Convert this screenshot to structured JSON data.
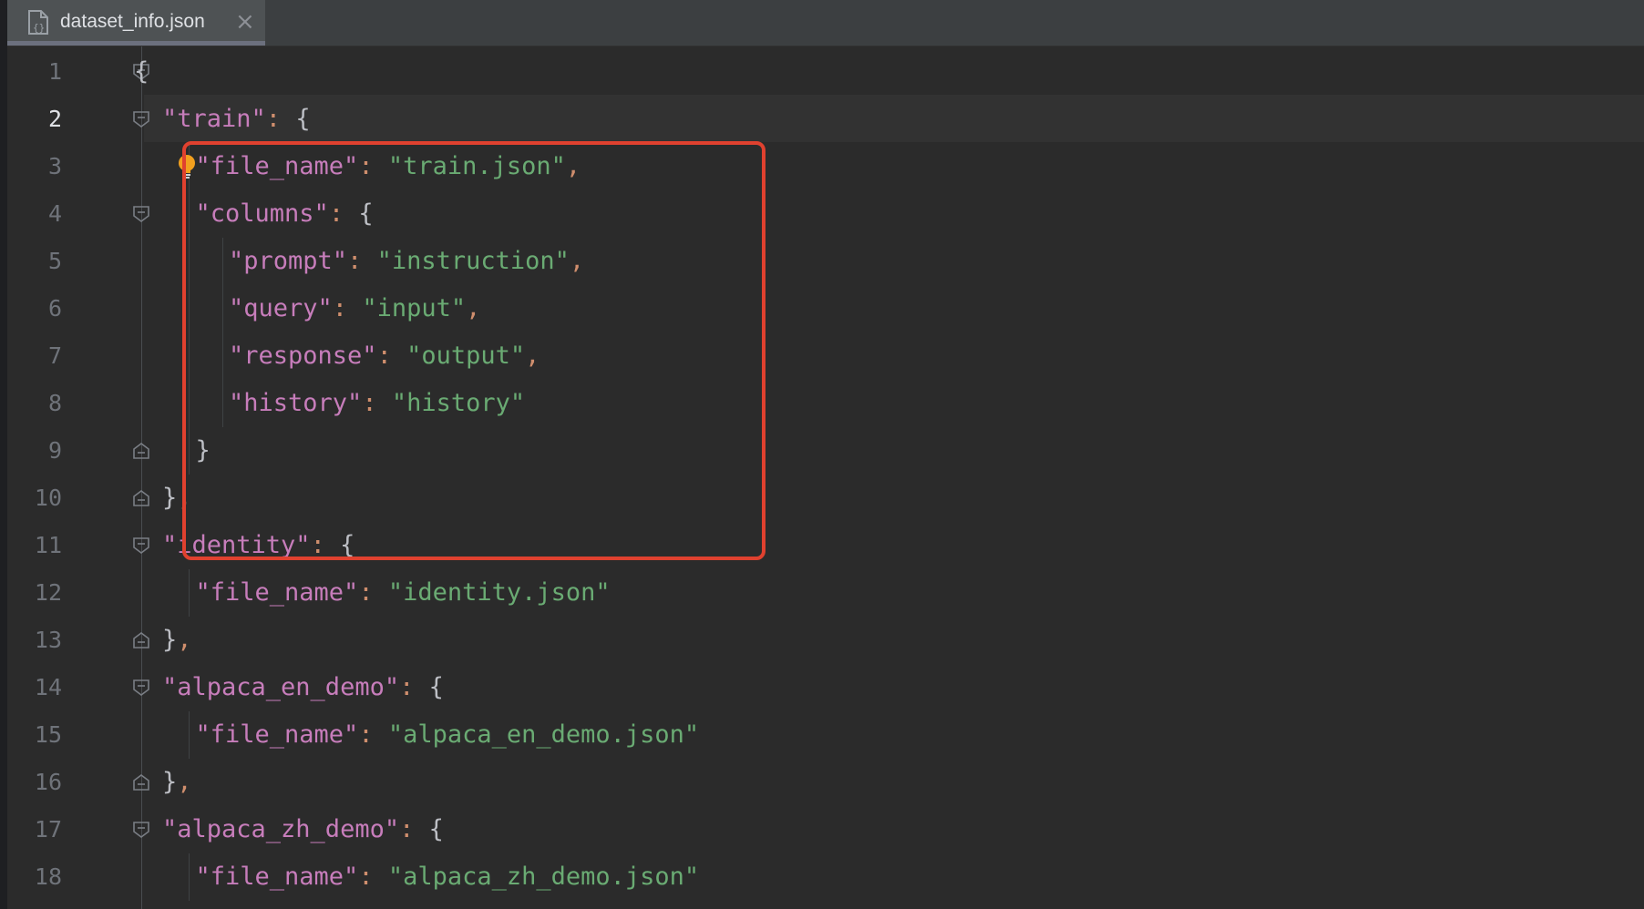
{
  "tab": {
    "title": "dataset_info.json",
    "close_symbol": "×",
    "icon": "json-file-icon"
  },
  "colors": {
    "background": "#2b2b2b",
    "key": "#c77dbb",
    "string": "#6aab73",
    "punctuation": "#bcbec4",
    "colon": "#cf8e6d",
    "highlight_box": "#e0412f"
  },
  "editor": {
    "current_line": 2,
    "highlight_lines": "2-10",
    "lines": [
      {
        "n": "1",
        "indent": 0,
        "fold": "open",
        "tokens": [
          {
            "t": "punc",
            "v": "{"
          }
        ]
      },
      {
        "n": "2",
        "indent": 1,
        "fold": "open",
        "tokens": [
          {
            "t": "key",
            "v": "\"train\""
          },
          {
            "t": "colon",
            "v": ": "
          },
          {
            "t": "punc",
            "v": "{"
          }
        ]
      },
      {
        "n": "3",
        "indent": 2,
        "fold": "none",
        "tokens": [
          {
            "t": "key",
            "v": "\"file_name\""
          },
          {
            "t": "colon",
            "v": ": "
          },
          {
            "t": "str",
            "v": "\"train.json\""
          },
          {
            "t": "comma",
            "v": ","
          }
        ]
      },
      {
        "n": "4",
        "indent": 2,
        "fold": "open",
        "tokens": [
          {
            "t": "key",
            "v": "\"columns\""
          },
          {
            "t": "colon",
            "v": ": "
          },
          {
            "t": "punc",
            "v": "{"
          }
        ]
      },
      {
        "n": "5",
        "indent": 3,
        "fold": "none",
        "tokens": [
          {
            "t": "key",
            "v": "\"prompt\""
          },
          {
            "t": "colon",
            "v": ": "
          },
          {
            "t": "str",
            "v": "\"instruction\""
          },
          {
            "t": "comma",
            "v": ","
          }
        ]
      },
      {
        "n": "6",
        "indent": 3,
        "fold": "none",
        "tokens": [
          {
            "t": "key",
            "v": "\"query\""
          },
          {
            "t": "colon",
            "v": ": "
          },
          {
            "t": "str",
            "v": "\"input\""
          },
          {
            "t": "comma",
            "v": ","
          }
        ]
      },
      {
        "n": "7",
        "indent": 3,
        "fold": "none",
        "tokens": [
          {
            "t": "key",
            "v": "\"response\""
          },
          {
            "t": "colon",
            "v": ": "
          },
          {
            "t": "str",
            "v": "\"output\""
          },
          {
            "t": "comma",
            "v": ","
          }
        ]
      },
      {
        "n": "8",
        "indent": 3,
        "fold": "none",
        "tokens": [
          {
            "t": "key",
            "v": "\"history\""
          },
          {
            "t": "colon",
            "v": ": "
          },
          {
            "t": "str",
            "v": "\"history\""
          }
        ]
      },
      {
        "n": "9",
        "indent": 2,
        "fold": "close",
        "tokens": [
          {
            "t": "punc",
            "v": "}"
          }
        ]
      },
      {
        "n": "10",
        "indent": 1,
        "fold": "close",
        "tokens": [
          {
            "t": "punc",
            "v": "}"
          },
          {
            "t": "comma",
            "v": ","
          }
        ]
      },
      {
        "n": "11",
        "indent": 1,
        "fold": "open",
        "tokens": [
          {
            "t": "key",
            "v": "\"identity\""
          },
          {
            "t": "colon",
            "v": ": "
          },
          {
            "t": "punc",
            "v": "{"
          }
        ]
      },
      {
        "n": "12",
        "indent": 2,
        "fold": "none",
        "tokens": [
          {
            "t": "key",
            "v": "\"file_name\""
          },
          {
            "t": "colon",
            "v": ": "
          },
          {
            "t": "str",
            "v": "\"identity.json\""
          }
        ]
      },
      {
        "n": "13",
        "indent": 1,
        "fold": "close",
        "tokens": [
          {
            "t": "punc",
            "v": "}"
          },
          {
            "t": "comma",
            "v": ","
          }
        ]
      },
      {
        "n": "14",
        "indent": 1,
        "fold": "open",
        "tokens": [
          {
            "t": "key",
            "v": "\"alpaca_en_demo\""
          },
          {
            "t": "colon",
            "v": ": "
          },
          {
            "t": "punc",
            "v": "{"
          }
        ]
      },
      {
        "n": "15",
        "indent": 2,
        "fold": "none",
        "tokens": [
          {
            "t": "key",
            "v": "\"file_name\""
          },
          {
            "t": "colon",
            "v": ": "
          },
          {
            "t": "str",
            "v": "\"alpaca_en_demo.json\""
          }
        ]
      },
      {
        "n": "16",
        "indent": 1,
        "fold": "close",
        "tokens": [
          {
            "t": "punc",
            "v": "}"
          },
          {
            "t": "comma",
            "v": ","
          }
        ]
      },
      {
        "n": "17",
        "indent": 1,
        "fold": "open",
        "tokens": [
          {
            "t": "key",
            "v": "\"alpaca_zh_demo\""
          },
          {
            "t": "colon",
            "v": ": "
          },
          {
            "t": "punc",
            "v": "{"
          }
        ]
      },
      {
        "n": "18",
        "indent": 2,
        "fold": "none",
        "tokens": [
          {
            "t": "key",
            "v": "\"file_name\""
          },
          {
            "t": "colon",
            "v": ": "
          },
          {
            "t": "str",
            "v": "\"alpaca_zh_demo.json\""
          }
        ]
      }
    ]
  }
}
